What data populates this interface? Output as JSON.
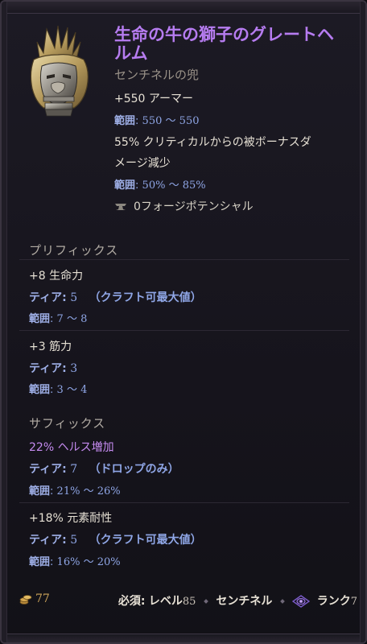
{
  "item": {
    "name": "生命の牛の獅子のグレートヘルム",
    "base_type": "センチネルの兜",
    "implicits": [
      {
        "text": "+550 アーマー",
        "range_label": "範囲",
        "range_sep": ":",
        "range_min": "550",
        "range_max": "550"
      },
      {
        "text_line1": "55% クリティカルからの被ボーナスダ",
        "text_line2": "メージ減少",
        "range_label": "範囲",
        "range_sep": ":",
        "range_min": "50%",
        "range_max": "85%"
      }
    ],
    "forge_potential": "0フォージポテンシャル"
  },
  "prefix": {
    "header": "プリフィックス",
    "affixes": [
      {
        "text": "+8 生命力",
        "tier_label": "ティア",
        "tier": "5",
        "tier_note": "（クラフト可最大値）",
        "range_label": "範囲",
        "range_min": "7",
        "range_max": "8"
      },
      {
        "text": "+3 筋力",
        "tier_label": "ティア",
        "tier": "3",
        "tier_note": "",
        "range_label": "範囲",
        "range_min": "3",
        "range_max": "4"
      }
    ]
  },
  "suffix": {
    "header": "サフィックス",
    "affixes": [
      {
        "text": "22% ヘルス増加",
        "tier_label": "ティア",
        "tier": "7",
        "tier_note": "（ドロップのみ）",
        "range_label": "範囲",
        "range_min": "21%",
        "range_max": "26%"
      },
      {
        "text": "+18% 元素耐性",
        "tier_label": "ティア",
        "tier": "5",
        "tier_note": "（クラフト可最大値）",
        "range_label": "範囲",
        "range_min": "16%",
        "range_max": "20%"
      }
    ]
  },
  "footer": {
    "gold_value": "77",
    "requirement_label": "必須:",
    "level_label": "レベル",
    "level": "85",
    "class_name": "センチネル",
    "rank_label": "ランク",
    "rank": "7"
  },
  "range_tilde": "〜",
  "colors": {
    "item_name": "#b67cf0",
    "range_blue": "#8fa6e6",
    "suffix_purple": "#c58bf0",
    "gold": "#cda55a"
  },
  "icons": [
    "helm-icon",
    "forge-anvil-icon",
    "gold-coins-icon",
    "rank-eye-icon"
  ]
}
